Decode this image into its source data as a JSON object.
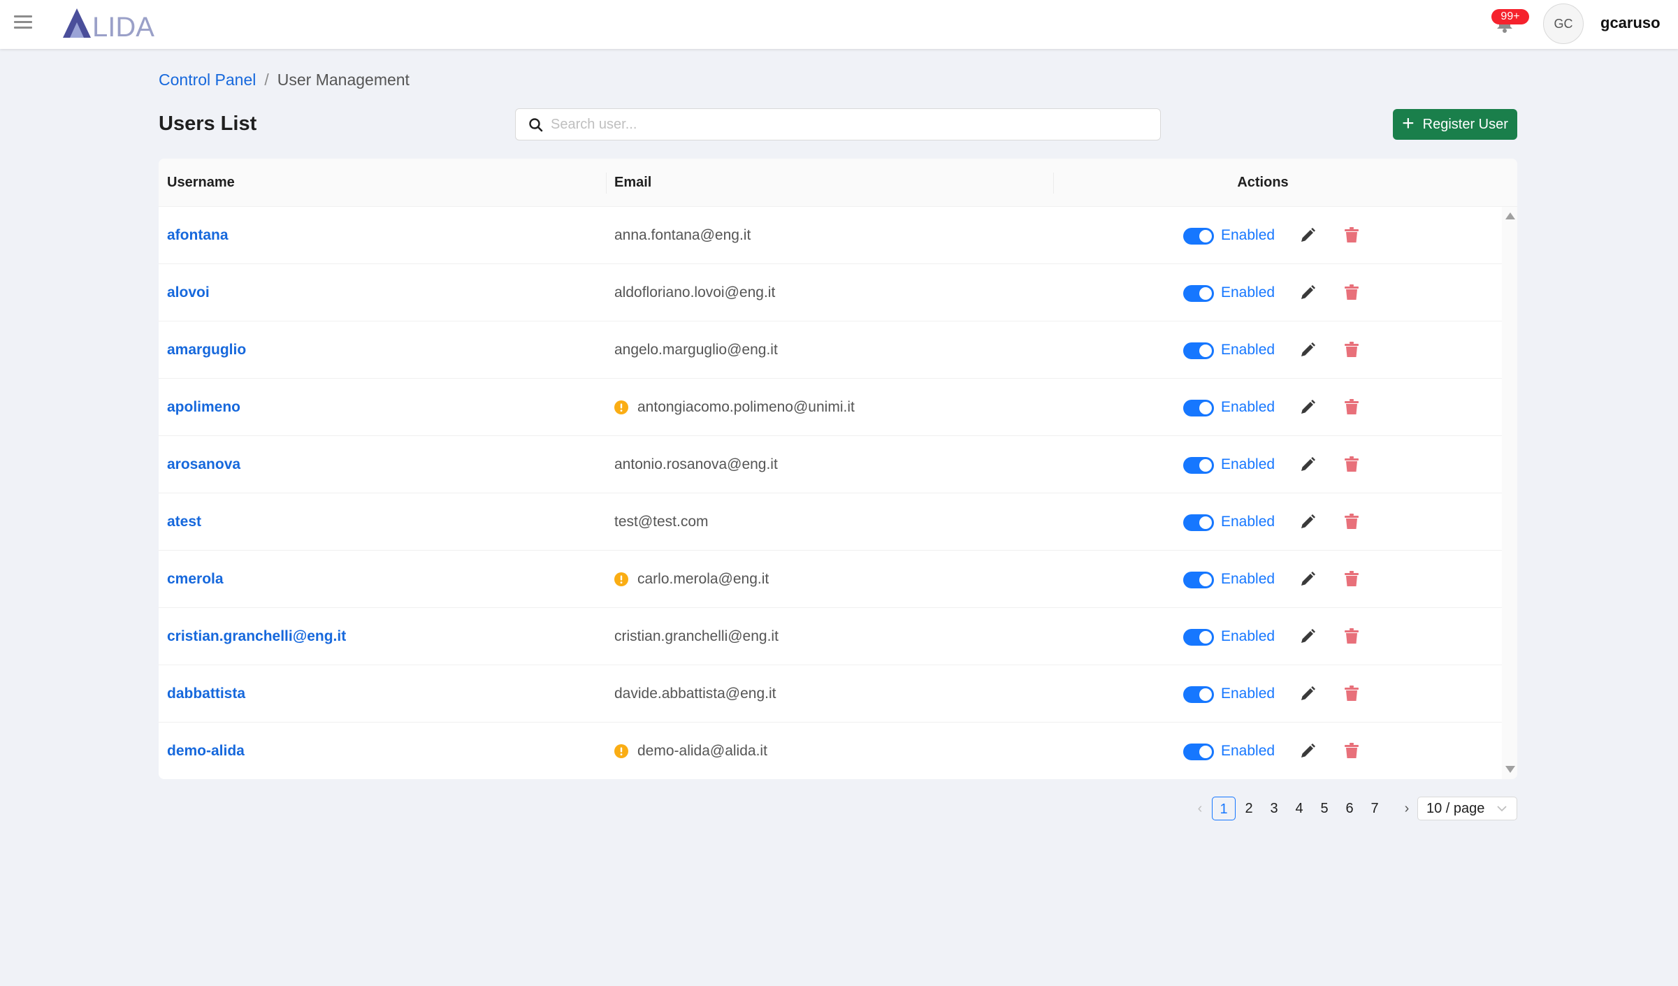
{
  "header": {
    "logo_text": "LIDA",
    "notification_count": "99+",
    "avatar_initials": "GC",
    "username": "gcaruso"
  },
  "breadcrumb": {
    "root": "Control Panel",
    "separator": "/",
    "current": "User Management"
  },
  "page": {
    "title": "Users List",
    "search_placeholder": "Search user...",
    "register_label": "Register User"
  },
  "table": {
    "columns": {
      "username": "Username",
      "email": "Email",
      "actions": "Actions"
    },
    "rows": [
      {
        "username": "afontana",
        "email": "anna.fontana@eng.it",
        "warning": false,
        "status": "Enabled"
      },
      {
        "username": "alovoi",
        "email": "aldofloriano.lovoi@eng.it",
        "warning": false,
        "status": "Enabled"
      },
      {
        "username": "amarguglio",
        "email": "angelo.marguglio@eng.it",
        "warning": false,
        "status": "Enabled"
      },
      {
        "username": "apolimeno",
        "email": "antongiacomo.polimeno@unimi.it",
        "warning": true,
        "status": "Enabled"
      },
      {
        "username": "arosanova",
        "email": "antonio.rosanova@eng.it",
        "warning": false,
        "status": "Enabled"
      },
      {
        "username": "atest",
        "email": "test@test.com",
        "warning": false,
        "status": "Enabled"
      },
      {
        "username": "cmerola",
        "email": "carlo.merola@eng.it",
        "warning": true,
        "status": "Enabled"
      },
      {
        "username": "cristian.granchelli@eng.it",
        "email": "cristian.granchelli@eng.it",
        "warning": false,
        "status": "Enabled"
      },
      {
        "username": "dabbattista",
        "email": "davide.abbattista@eng.it",
        "warning": false,
        "status": "Enabled"
      },
      {
        "username": "demo-alida",
        "email": "demo-alida@alida.it",
        "warning": true,
        "status": "Enabled"
      }
    ]
  },
  "pagination": {
    "pages": [
      "1",
      "2",
      "3",
      "4",
      "5",
      "6",
      "7"
    ],
    "current_page": "1",
    "page_size": "10 / page"
  },
  "colors": {
    "brand_link": "#1668dc",
    "register_button": "#1a7f4b",
    "toggle_on": "#1677ff",
    "delete_icon": "#e8707a",
    "warning_icon": "#faad14",
    "badge": "#f5222d"
  },
  "icons": {
    "menu": "hamburger-icon",
    "notifications": "bell-icon",
    "search": "search-icon",
    "register": "plus-icon",
    "edit": "pencil-icon",
    "delete": "trash-icon",
    "warning": "exclamation-circle-icon"
  }
}
